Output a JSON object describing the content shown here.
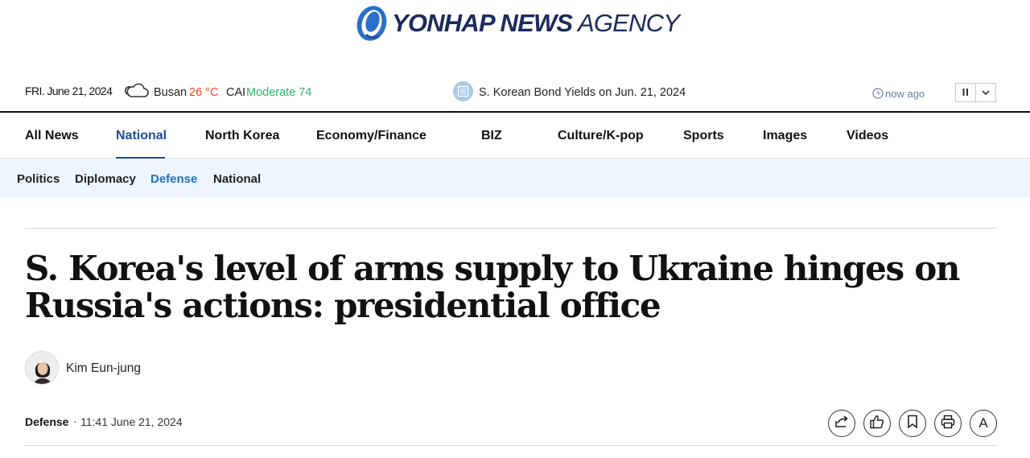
{
  "logo": {
    "bold": "YONHAP NEWS",
    "light": "AGENCY"
  },
  "util": {
    "date": "FRI. June 21, 2024",
    "city": "Busan",
    "temp": "26 °C",
    "cai_label": "CAI",
    "cai_value": "Moderate 74",
    "ticker": "S. Korean Bond Yields on Jun. 21, 2024",
    "time": "now ago"
  },
  "gnb": [
    "All News",
    "National",
    "North Korea",
    "Economy/Finance",
    "BIZ",
    "Culture/K-pop",
    "Sports",
    "Images",
    "Videos"
  ],
  "subnav": [
    "Politics",
    "Diplomacy",
    "Defense",
    "National"
  ],
  "article": {
    "headline": "S. Korea's level of arms supply to Ukraine hinges on Russia's actions: presidential office",
    "author": "Kim Eun-jung",
    "section": "Defense",
    "separator": "·",
    "timestamp": "11:41 June 21, 2024"
  },
  "tools": {
    "font_size_letter": "A"
  },
  "colors": {
    "brand_navy": "#1c2b5c",
    "active_nav": "#1f4b9a",
    "active_sub": "#1f6fce",
    "temp": "#e04a1f",
    "cai": "#2fb56a"
  }
}
